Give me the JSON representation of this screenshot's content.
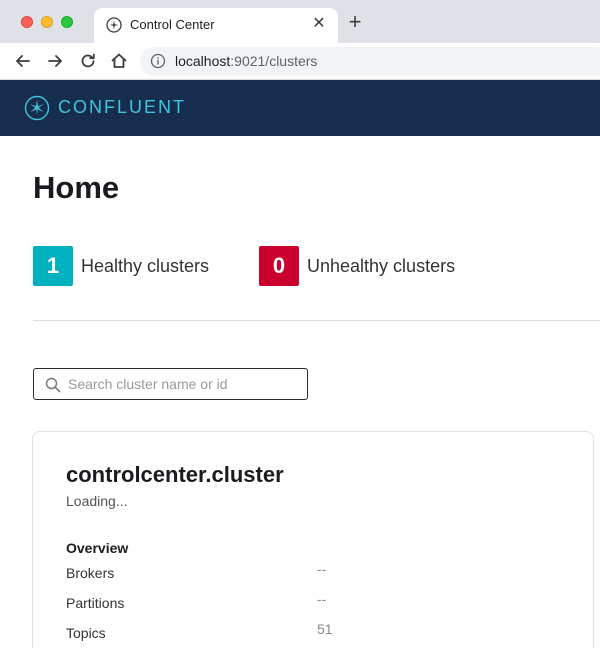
{
  "browser": {
    "tab_title": "Control Center",
    "tab_close": "✕",
    "new_tab": "+",
    "url_host": "localhost",
    "url_path": ":9021/clusters"
  },
  "brand": {
    "name": "CONFLUENT",
    "accent_color": "#3fc5dd",
    "header_color": "#172d4d"
  },
  "page": {
    "title": "Home"
  },
  "stats": {
    "healthy": {
      "count": "1",
      "label": "Healthy clusters",
      "color": "#00b1c0"
    },
    "unhealthy": {
      "count": "0",
      "label": "Unhealthy clusters",
      "color": "#c9002e"
    }
  },
  "search": {
    "placeholder": "Search cluster name or id",
    "value": ""
  },
  "cluster": {
    "name": "controlcenter.cluster",
    "status": "Loading...",
    "overview_heading": "Overview",
    "metrics": [
      {
        "label": "Brokers",
        "value": "--"
      },
      {
        "label": "Partitions",
        "value": "--"
      },
      {
        "label": "Topics",
        "value": "51"
      }
    ]
  },
  "icons": {
    "favicon": "confluent-favicon-icon",
    "back": "arrow-left-icon",
    "forward": "arrow-right-icon",
    "reload": "reload-icon",
    "home": "home-icon",
    "info": "info-icon",
    "search": "search-icon",
    "logo": "confluent-logo-icon"
  }
}
